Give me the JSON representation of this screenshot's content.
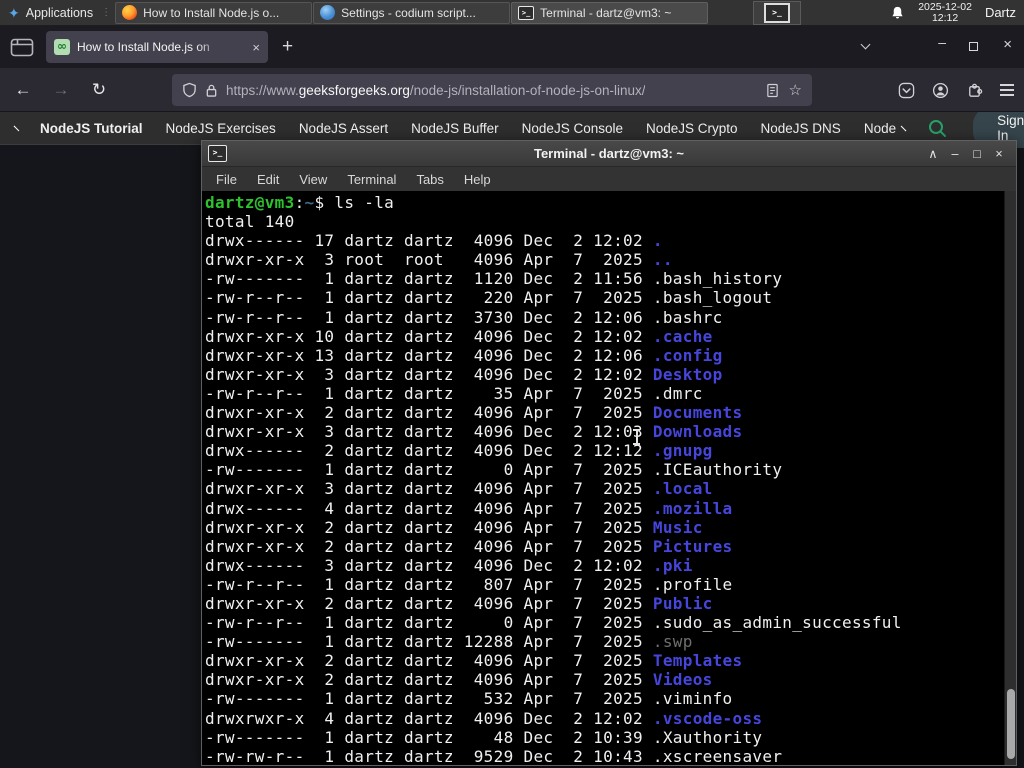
{
  "colors": {
    "term-green": "#2dc22d",
    "term-dir": "#4646dc",
    "term-dim": "#6f6f6f",
    "term-fg": "#f0f0f0",
    "term-path": "#3c6a87",
    "gfg-green": "#26a269"
  },
  "panel": {
    "applications_label": "Applications",
    "tasks": [
      {
        "title": "How to Install Node.js o...",
        "icon": "firefox"
      },
      {
        "title": "Settings - codium script...",
        "icon": "vscodium"
      },
      {
        "title": "Terminal - dartz@vm3: ~",
        "icon": "terminal"
      }
    ],
    "clock_date": "2025-12-02",
    "clock_time": "12:12",
    "username": "Dartz"
  },
  "browser": {
    "tab_title": "How to Install Node.js on",
    "url_scheme": "https://www.",
    "url_host": "geeksforgeeks.org",
    "url_path": "/node-js/installation-of-node-js-on-linux/"
  },
  "site_nav": {
    "items": [
      "NodeJS Tutorial",
      "NodeJS Exercises",
      "NodeJS Assert",
      "NodeJS Buffer",
      "NodeJS Console",
      "NodeJS Crypto",
      "NodeJS DNS",
      "Node"
    ],
    "sign_in_label": "Sign In"
  },
  "terminal": {
    "window_title": "Terminal - dartz@vm3: ~",
    "menu_items": [
      "File",
      "Edit",
      "View",
      "Terminal",
      "Tabs",
      "Help"
    ],
    "prompt_user_host": "dartz@vm3",
    "prompt_colon": ":",
    "prompt_path": "~",
    "prompt_rest": "$ ls -la",
    "total_line": "total 140",
    "listing": [
      {
        "pre": "drwx------ 17 dartz dartz  4096 Dec  2 12:02 ",
        "name": ".",
        "type": "dir"
      },
      {
        "pre": "drwxr-xr-x  3 root  root   4096 Apr  7  2025 ",
        "name": "..",
        "type": "dir"
      },
      {
        "pre": "-rw-------  1 dartz dartz  1120 Dec  2 11:56 ",
        "name": ".bash_history",
        "type": "file"
      },
      {
        "pre": "-rw-r--r--  1 dartz dartz   220 Apr  7  2025 ",
        "name": ".bash_logout",
        "type": "file"
      },
      {
        "pre": "-rw-r--r--  1 dartz dartz  3730 Dec  2 12:06 ",
        "name": ".bashrc",
        "type": "file"
      },
      {
        "pre": "drwxr-xr-x 10 dartz dartz  4096 Dec  2 12:02 ",
        "name": ".cache",
        "type": "dir"
      },
      {
        "pre": "drwxr-xr-x 13 dartz dartz  4096 Dec  2 12:06 ",
        "name": ".config",
        "type": "dir"
      },
      {
        "pre": "drwxr-xr-x  3 dartz dartz  4096 Dec  2 12:02 ",
        "name": "Desktop",
        "type": "dir"
      },
      {
        "pre": "-rw-r--r--  1 dartz dartz    35 Apr  7  2025 ",
        "name": ".dmrc",
        "type": "file"
      },
      {
        "pre": "drwxr-xr-x  2 dartz dartz  4096 Apr  7  2025 ",
        "name": "Documents",
        "type": "dir"
      },
      {
        "pre": "drwxr-xr-x  3 dartz dartz  4096 Dec  2 12:03 ",
        "name": "Downloads",
        "type": "dir"
      },
      {
        "pre": "drwx------  2 dartz dartz  4096 Dec  2 12:12 ",
        "name": ".gnupg",
        "type": "dir"
      },
      {
        "pre": "-rw-------  1 dartz dartz     0 Apr  7  2025 ",
        "name": ".ICEauthority",
        "type": "file"
      },
      {
        "pre": "drwxr-xr-x  3 dartz dartz  4096 Apr  7  2025 ",
        "name": ".local",
        "type": "dir"
      },
      {
        "pre": "drwx------  4 dartz dartz  4096 Apr  7  2025 ",
        "name": ".mozilla",
        "type": "dir"
      },
      {
        "pre": "drwxr-xr-x  2 dartz dartz  4096 Apr  7  2025 ",
        "name": "Music",
        "type": "dir"
      },
      {
        "pre": "drwxr-xr-x  2 dartz dartz  4096 Apr  7  2025 ",
        "name": "Pictures",
        "type": "dir"
      },
      {
        "pre": "drwx------  3 dartz dartz  4096 Dec  2 12:02 ",
        "name": ".pki",
        "type": "dir"
      },
      {
        "pre": "-rw-r--r--  1 dartz dartz   807 Apr  7  2025 ",
        "name": ".profile",
        "type": "file"
      },
      {
        "pre": "drwxr-xr-x  2 dartz dartz  4096 Apr  7  2025 ",
        "name": "Public",
        "type": "dir"
      },
      {
        "pre": "-rw-r--r--  1 dartz dartz     0 Apr  7  2025 ",
        "name": ".sudo_as_admin_successful",
        "type": "file"
      },
      {
        "pre": "-rw-------  1 dartz dartz 12288 Apr  7  2025 ",
        "name": ".swp",
        "type": "dim"
      },
      {
        "pre": "drwxr-xr-x  2 dartz dartz  4096 Apr  7  2025 ",
        "name": "Templates",
        "type": "dir"
      },
      {
        "pre": "drwxr-xr-x  2 dartz dartz  4096 Apr  7  2025 ",
        "name": "Videos",
        "type": "dir"
      },
      {
        "pre": "-rw-------  1 dartz dartz   532 Apr  7  2025 ",
        "name": ".viminfo",
        "type": "file"
      },
      {
        "pre": "drwxrwxr-x  4 dartz dartz  4096 Dec  2 12:02 ",
        "name": ".vscode-oss",
        "type": "dir"
      },
      {
        "pre": "-rw-------  1 dartz dartz    48 Dec  2 10:39 ",
        "name": ".Xauthority",
        "type": "file"
      },
      {
        "pre": "-rw-rw-r--  1 dartz dartz  9529 Dec  2 10:43 ",
        "name": ".xscreensaver",
        "type": "file"
      }
    ]
  }
}
